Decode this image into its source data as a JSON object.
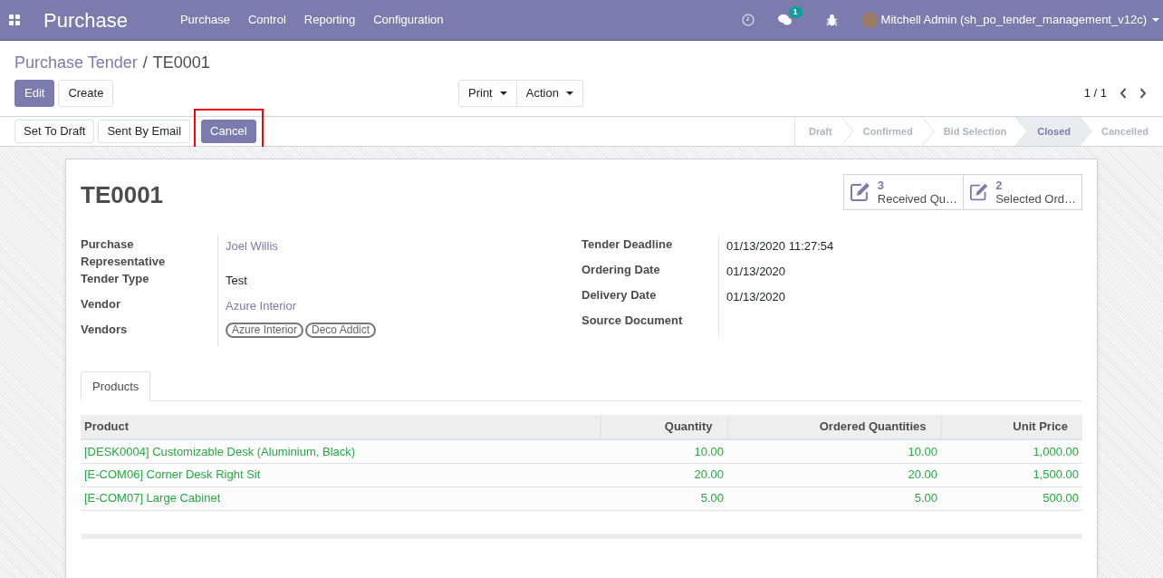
{
  "navbar": {
    "app_title": "Purchase",
    "menus": [
      "Purchase",
      "Control",
      "Reporting",
      "Configuration"
    ],
    "message_count": "1",
    "user": "Mitchell Admin (sh_po_tender_management_v12c)"
  },
  "breadcrumb": {
    "parent": "Purchase Tender",
    "separator": "/",
    "current": "TE0001"
  },
  "toolbar": {
    "buttons": [
      {
        "label": "Edit",
        "kind": "primary"
      },
      {
        "label": "Create",
        "kind": "secondary"
      }
    ],
    "dropdowns": [
      "Print",
      "Action"
    ],
    "pager": "1 / 1"
  },
  "header_buttons": [
    {
      "label": "Set To Draft",
      "kind": "secondary",
      "highlighted": false
    },
    {
      "label": "Sent By Email",
      "kind": "secondary",
      "highlighted": false
    },
    {
      "label": "Cancel",
      "kind": "primary",
      "highlighted": true
    }
  ],
  "stages": [
    {
      "label": "Draft",
      "selected": false
    },
    {
      "label": "Confirmed",
      "selected": false
    },
    {
      "label": "Bid Selection",
      "selected": false
    },
    {
      "label": "Closed",
      "selected": true
    },
    {
      "label": "Cancelled",
      "selected": false
    }
  ],
  "record": {
    "title": "TE0001",
    "smart_buttons": [
      {
        "count": "3",
        "label": "Received Qu…"
      },
      {
        "count": "2",
        "label": "Selected Ord…"
      }
    ],
    "left_fields": [
      {
        "label": "Purchase Representative",
        "value": "Joel Willis",
        "kind": "link"
      },
      {
        "label": "Tender Type",
        "value": "Test",
        "kind": "text"
      },
      {
        "label": "Vendor",
        "value": "Azure Interior",
        "kind": "link"
      },
      {
        "label": "Vendors",
        "tags": [
          "Azure Interior",
          "Deco Addict"
        ],
        "kind": "tags"
      }
    ],
    "right_fields": [
      {
        "label": "Tender Deadline",
        "value": "01/13/2020 11:27:54",
        "kind": "text"
      },
      {
        "label": "Ordering Date",
        "value": "01/13/2020",
        "kind": "text"
      },
      {
        "label": "Delivery Date",
        "value": "01/13/2020",
        "kind": "text"
      },
      {
        "label": "Source Document",
        "kind": "empty"
      }
    ],
    "tabs": [
      {
        "label": "Products",
        "selected": true
      }
    ],
    "table": {
      "columns": [
        "Product",
        "Quantity",
        "Ordered Quantities",
        "Unit Price"
      ],
      "rows": [
        [
          "[DESK0004] Customizable Desk (Aluminium, Black)",
          "10.00",
          "10.00",
          "1,000.00"
        ],
        [
          "[E-COM06] Corner Desk Right Sit",
          "20.00",
          "20.00",
          "1,500.00"
        ],
        [
          "[E-COM07] Large Cabinet",
          "5.00",
          "5.00",
          "500.00"
        ]
      ]
    }
  }
}
